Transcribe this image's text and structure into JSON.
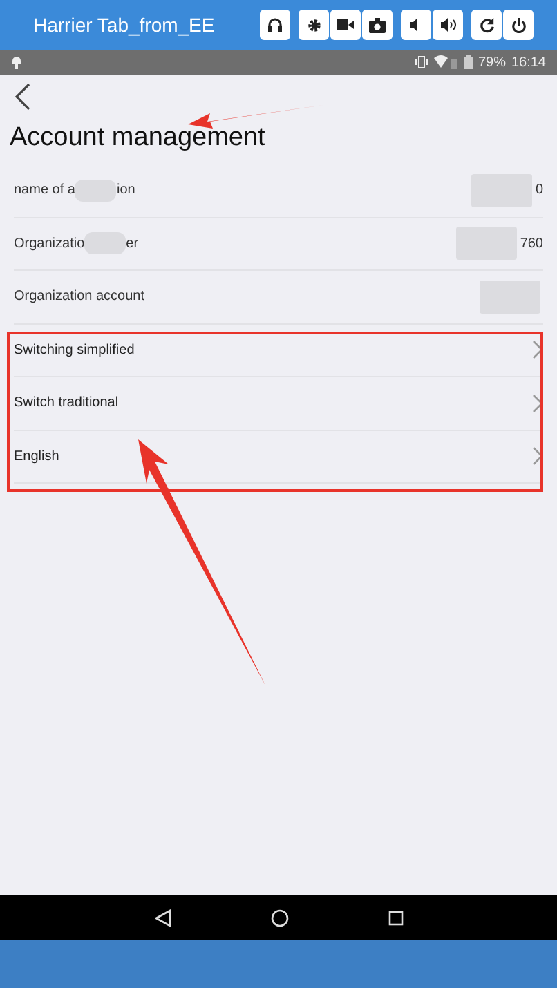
{
  "emulator_bar": {
    "title": "Harrier Tab_from_EE"
  },
  "status_bar": {
    "battery": "79%",
    "time": "16:14"
  },
  "page": {
    "title": "Account management"
  },
  "info_rows": [
    {
      "label_parts": [
        "name of a",
        "ion"
      ],
      "value": "0"
    },
    {
      "label_parts": [
        "Organizatio",
        "er"
      ],
      "value": "760"
    },
    {
      "label_parts": [
        "Organization account"
      ],
      "value": ""
    }
  ],
  "menu_rows": [
    {
      "label": "Switching simplified"
    },
    {
      "label": "Switch traditional"
    },
    {
      "label": "English"
    }
  ]
}
